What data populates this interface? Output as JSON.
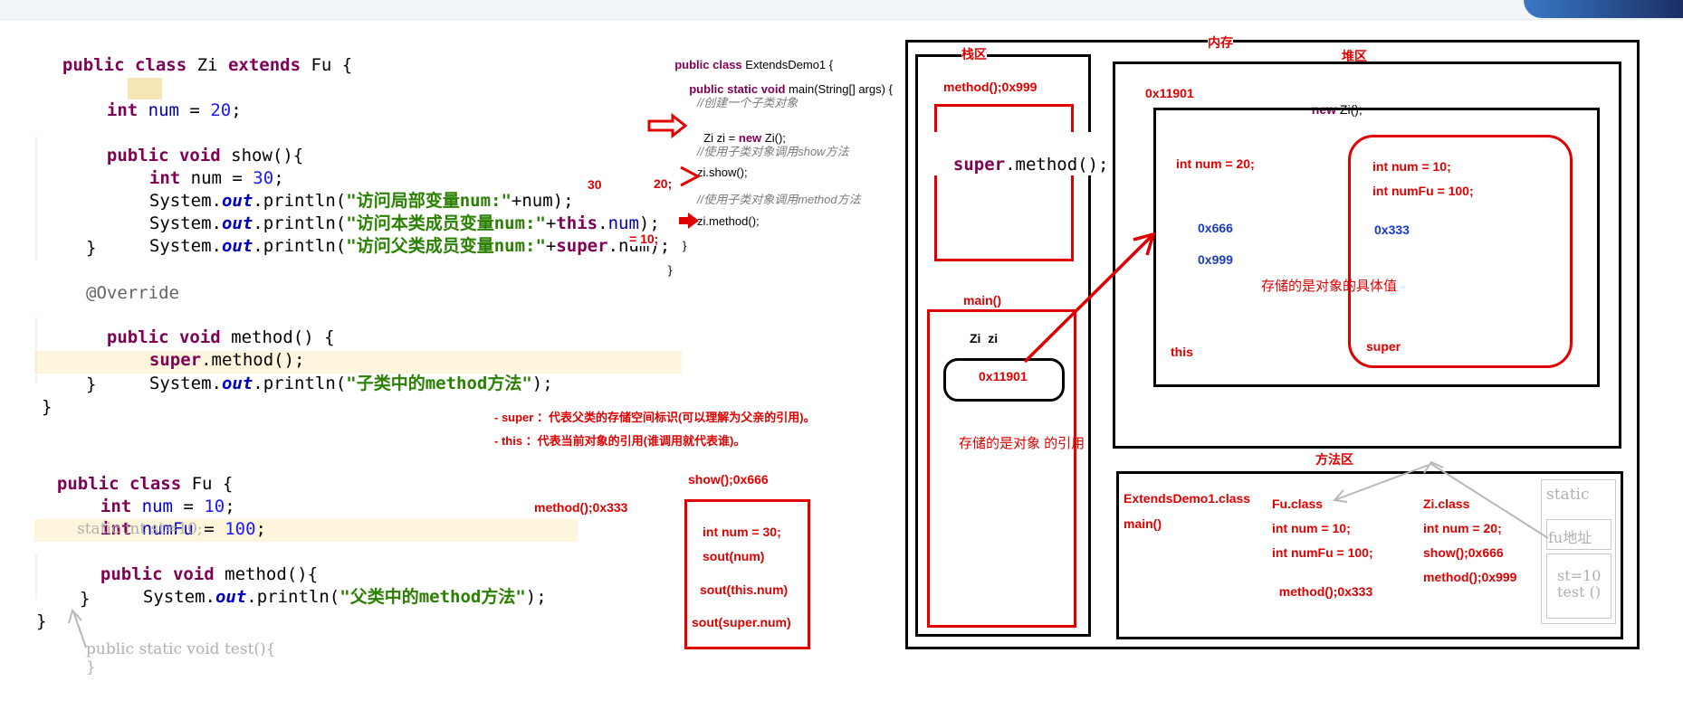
{
  "zi_code": {
    "l1": [
      "public class ",
      "Zi ",
      "extends ",
      "Fu {"
    ],
    "field": [
      "int ",
      "num",
      " = ",
      "20",
      ";"
    ],
    "show_sig": [
      "public void ",
      "show(){"
    ],
    "local": [
      "int ",
      "num = ",
      "30",
      ";"
    ],
    "p1": [
      "System.",
      "out",
      ".println(",
      "\"访问局部变量num:\"",
      "+num);"
    ],
    "p2": [
      "System.",
      "out",
      ".println(",
      "\"访问本类成员变量num:\"",
      "+",
      "this",
      ".",
      "num",
      ");"
    ],
    "p3": [
      "System.",
      "out",
      ".println(",
      "\"访问父类成员变量num:\"",
      "+",
      "super",
      ".num);"
    ],
    "close1": "}",
    "override": "@Override",
    "method_sig": [
      "public void ",
      "method() {"
    ],
    "super_call": [
      "super",
      ".method();"
    ],
    "p4": [
      "System.",
      "out",
      ".println(",
      "\"子类中的method方法\"",
      ");"
    ],
    "close2": "}",
    "close3": "}"
  },
  "fu_code": {
    "l1": [
      "public class ",
      "Fu {"
    ],
    "f1": [
      "int ",
      "num",
      " = ",
      "10",
      ";"
    ],
    "f2": [
      "int ",
      "numFu",
      " = ",
      "100",
      ";"
    ],
    "static_line": "static int st=10;",
    "m_sig": [
      "public void ",
      "method(){"
    ],
    "p1": [
      "System.",
      "out",
      ".println(",
      "\"父类中的method方法\"",
      ");"
    ],
    "close1": "}",
    "close2": "}",
    "test1": "public static void test(){",
    "test2": "}"
  },
  "demo_code": {
    "l1": [
      "public class ",
      "ExtendsDemo1 {"
    ],
    "l2": [
      "public static void ",
      "main(String[] args) {"
    ],
    "c1": "//创建一个子类对象",
    "l3": [
      "Zi zi = ",
      "new ",
      "Zi();"
    ],
    "c2": "//使用子类对象调用show方法",
    "l4": "zi.show();",
    "c3": "//使用子类对象调用method方法",
    "l5": "zi.method();",
    "l6": "}",
    "l7": "}"
  },
  "annotations": {
    "v30": "30",
    "v20": "20;",
    "v10": "= 10;",
    "super_note": "- super ：代表父类的存储空间标识(可以理解为父亲的引用)。",
    "this_note": "- this ：代表当前对象的引用(谁调用就代表谁)。",
    "show_frame_title": "show();0x666",
    "show_frame_items": [
      "int num = 30;",
      "sout(num)",
      "sout(this.num)",
      "sout(super.num)"
    ],
    "fu_method_label": "method();0x333"
  },
  "memory": {
    "title": "内存",
    "stack_title": "栈区",
    "heap_title": "堆区",
    "method_area_title": "方法区",
    "stack_method_frame": "method();0x999",
    "stack_super_call": [
      "super",
      ".method();"
    ],
    "main_frame": "main()",
    "zi_var": "Zi  zi",
    "zi_ref": "0x11901",
    "ref_note": "存储的是对象 的引用",
    "heap_addr": "0x11901",
    "heap_new": [
      "new ",
      "Zi();"
    ],
    "zi_field": "int num = 20;",
    "zi_addr1": "0x666",
    "zi_addr2": "0x999",
    "this_label": "this",
    "fu_field1": "int num = 10;",
    "fu_field2": "int numFu = 100;",
    "fu_addr": "0x333",
    "super_label": "super",
    "value_note": "存储的是对象的具体值",
    "ma_demo_class": "ExtendsDemo1.class",
    "ma_main": "main()",
    "ma_fu": [
      "Fu.class",
      "int num = 10;",
      "int numFu = 100;",
      "method();0x333"
    ],
    "ma_zi": [
      "Zi.class",
      "int num = 20;",
      "show();0x666",
      "method();0x999"
    ],
    "static_title": "static",
    "static_fu": "fu地址",
    "static_st": "st=10",
    "static_test": "test ()"
  }
}
